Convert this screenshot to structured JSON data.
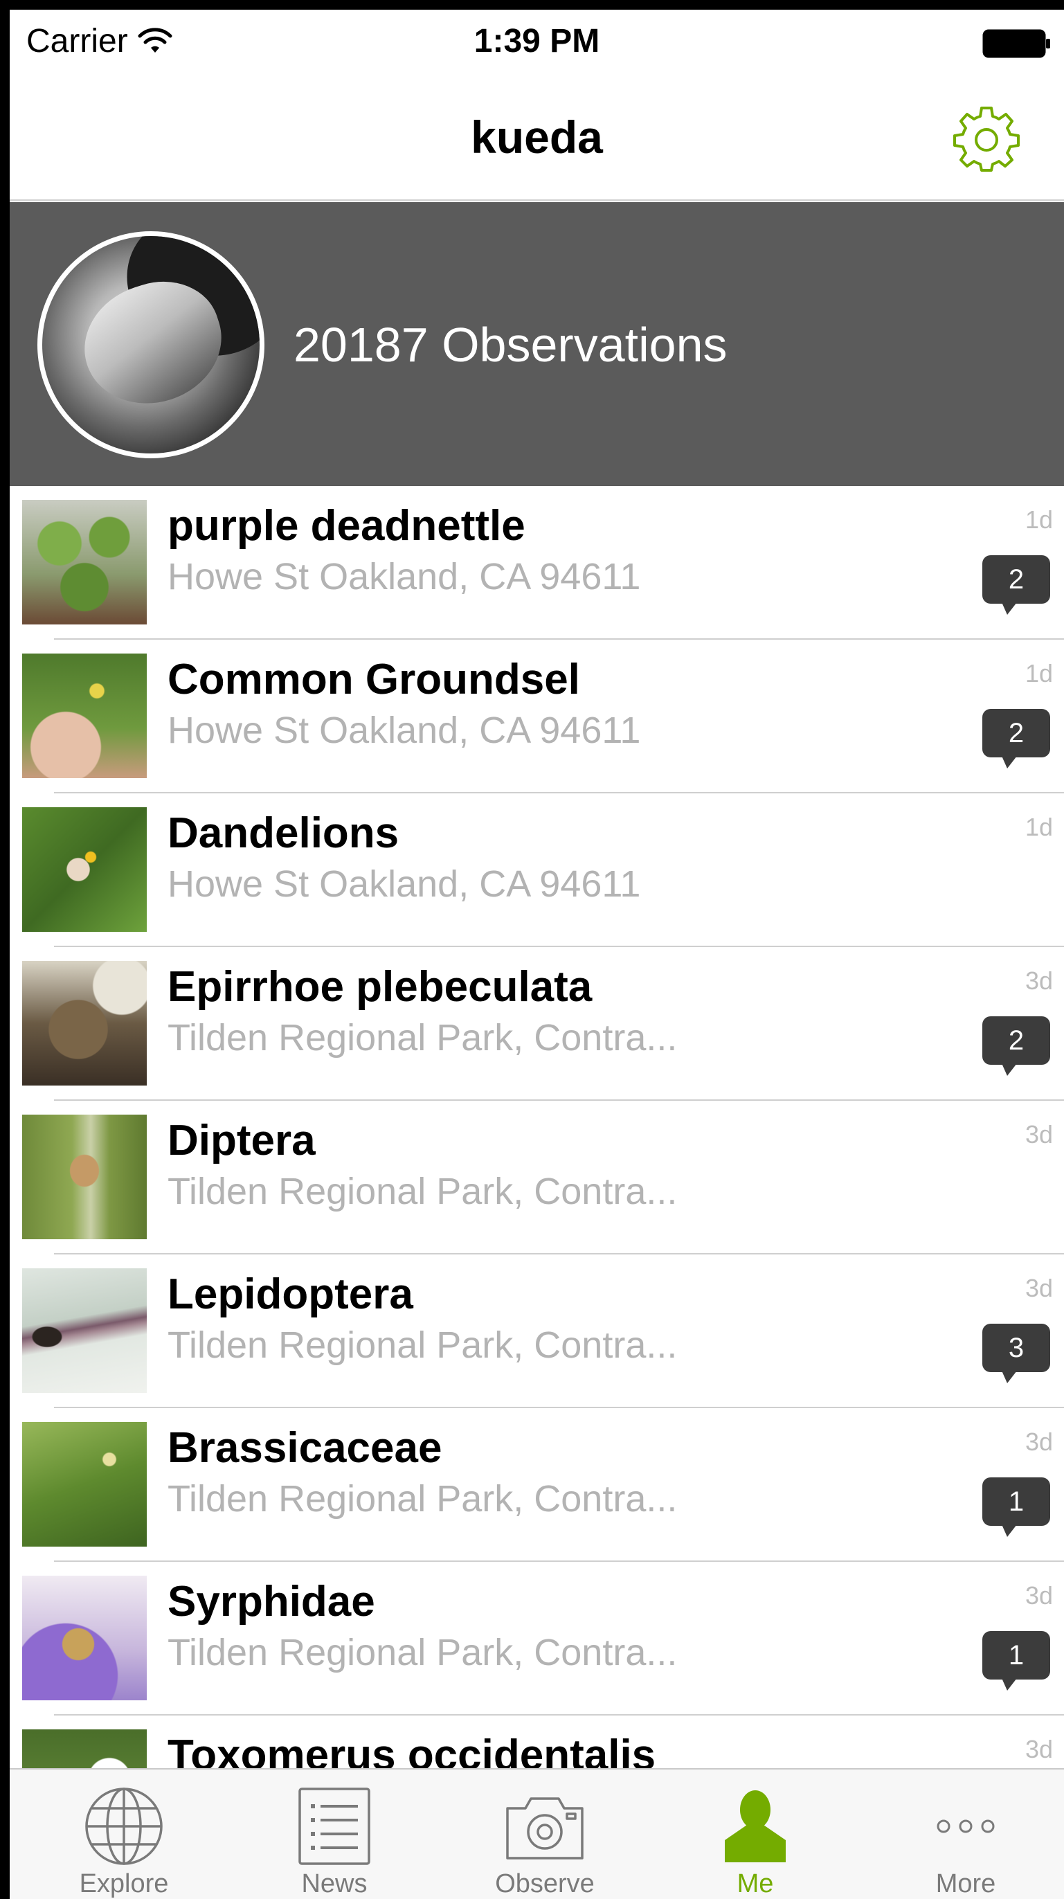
{
  "status_bar": {
    "carrier": "Carrier",
    "time": "1:39 PM"
  },
  "nav": {
    "title": "kueda",
    "settings_icon": "gear-icon",
    "accent_color": "#74ac00"
  },
  "profile": {
    "observations_label": "20187 Observations",
    "header_color": "#5b5b5b"
  },
  "observations": [
    {
      "title": "purple deadnettle",
      "place": "Howe St Oakland, CA 94611",
      "age": "1d",
      "comments": "2"
    },
    {
      "title": "Common Groundsel",
      "place": "Howe St Oakland, CA 94611",
      "age": "1d",
      "comments": "2"
    },
    {
      "title": "Dandelions",
      "place": "Howe St Oakland, CA 94611",
      "age": "1d",
      "comments": ""
    },
    {
      "title": "Epirrhoe plebeculata",
      "place": "Tilden Regional Park, Contra...",
      "age": "3d",
      "comments": "2"
    },
    {
      "title": "Diptera",
      "place": "Tilden Regional Park, Contra...",
      "age": "3d",
      "comments": ""
    },
    {
      "title": "Lepidoptera",
      "place": "Tilden Regional Park, Contra...",
      "age": "3d",
      "comments": "3"
    },
    {
      "title": "Brassicaceae",
      "place": "Tilden Regional Park, Contra...",
      "age": "3d",
      "comments": "1"
    },
    {
      "title": "Syrphidae",
      "place": "Tilden Regional Park, Contra...",
      "age": "3d",
      "comments": "1"
    },
    {
      "title": "Toxomerus occidentalis",
      "place": "",
      "age": "3d",
      "comments": ""
    }
  ],
  "tabs": [
    {
      "label": "Explore",
      "icon": "globe-icon"
    },
    {
      "label": "News",
      "icon": "news-list-icon"
    },
    {
      "label": "Observe",
      "icon": "camera-icon"
    },
    {
      "label": "Me",
      "icon": "person-icon",
      "active": true
    },
    {
      "label": "More",
      "icon": "more-dots-icon"
    }
  ]
}
